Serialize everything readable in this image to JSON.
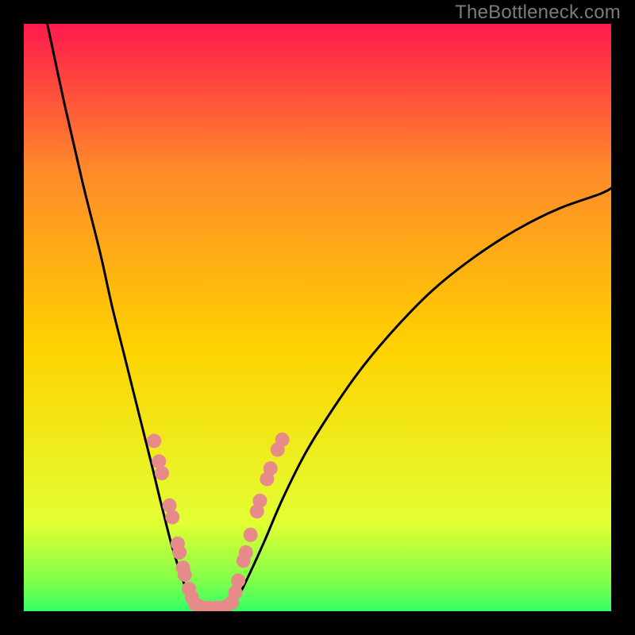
{
  "watermark": "TheBottleneck.com",
  "chart_data": {
    "type": "line",
    "title": "",
    "xlabel": "",
    "ylabel": "",
    "xlim": [
      0,
      100
    ],
    "ylim": [
      0,
      100
    ],
    "background_gradient": {
      "bottom": "#33ff66",
      "mid": "#ffe600",
      "top": "#ff1a4d"
    },
    "green_band_top": 6,
    "series": [
      {
        "name": "left-branch",
        "x": [
          4,
          7,
          10,
          13,
          15,
          17,
          19,
          20.5,
          22,
          23.2,
          24.2,
          25.1,
          26.0,
          26.8,
          27.5,
          28.2,
          28.8,
          29.4
        ],
        "values": [
          100,
          86,
          73,
          61,
          52,
          44,
          36,
          30,
          24,
          19,
          15,
          11.5,
          8.5,
          6.0,
          4.2,
          2.8,
          1.6,
          0.8
        ]
      },
      {
        "name": "floor",
        "x": [
          29.4,
          31.0,
          33.0,
          35.0
        ],
        "values": [
          0.8,
          0.6,
          0.6,
          0.8
        ]
      },
      {
        "name": "right-branch",
        "x": [
          35.0,
          36.5,
          38.5,
          41,
          44,
          48,
          53,
          58,
          64,
          70,
          77,
          84,
          91,
          98,
          100
        ],
        "values": [
          0.8,
          2.5,
          6.5,
          12,
          19,
          27,
          35,
          42,
          49,
          55,
          60.5,
          65,
          68.5,
          71,
          72
        ]
      }
    ],
    "markers": [
      {
        "name": "left-dots",
        "color": "#e78a8a",
        "points": [
          {
            "x": 22.2,
            "y": 29.0
          },
          {
            "x": 23.0,
            "y": 25.5
          },
          {
            "x": 23.5,
            "y": 23.5
          },
          {
            "x": 24.8,
            "y": 18.0
          },
          {
            "x": 25.3,
            "y": 16.0
          },
          {
            "x": 26.2,
            "y": 11.5
          },
          {
            "x": 26.5,
            "y": 10.0
          },
          {
            "x": 27.1,
            "y": 7.4
          },
          {
            "x": 27.4,
            "y": 6.2
          },
          {
            "x": 28.1,
            "y": 3.8
          },
          {
            "x": 28.6,
            "y": 2.4
          },
          {
            "x": 29.2,
            "y": 1.2
          }
        ]
      },
      {
        "name": "floor-dots",
        "color": "#e78a8a",
        "points": [
          {
            "x": 30.2,
            "y": 0.7
          },
          {
            "x": 31.5,
            "y": 0.6
          },
          {
            "x": 33.0,
            "y": 0.6
          },
          {
            "x": 34.3,
            "y": 0.7
          }
        ]
      },
      {
        "name": "right-dots",
        "color": "#e78a8a",
        "points": [
          {
            "x": 35.4,
            "y": 1.5
          },
          {
            "x": 36.0,
            "y": 3.2
          },
          {
            "x": 36.5,
            "y": 5.2
          },
          {
            "x": 37.4,
            "y": 8.6
          },
          {
            "x": 37.8,
            "y": 10.0
          },
          {
            "x": 38.6,
            "y": 13.0
          },
          {
            "x": 39.7,
            "y": 17.0
          },
          {
            "x": 40.2,
            "y": 18.8
          },
          {
            "x": 41.4,
            "y": 22.5
          },
          {
            "x": 42.0,
            "y": 24.3
          },
          {
            "x": 43.2,
            "y": 27.5
          },
          {
            "x": 44.0,
            "y": 29.2
          }
        ]
      }
    ]
  }
}
